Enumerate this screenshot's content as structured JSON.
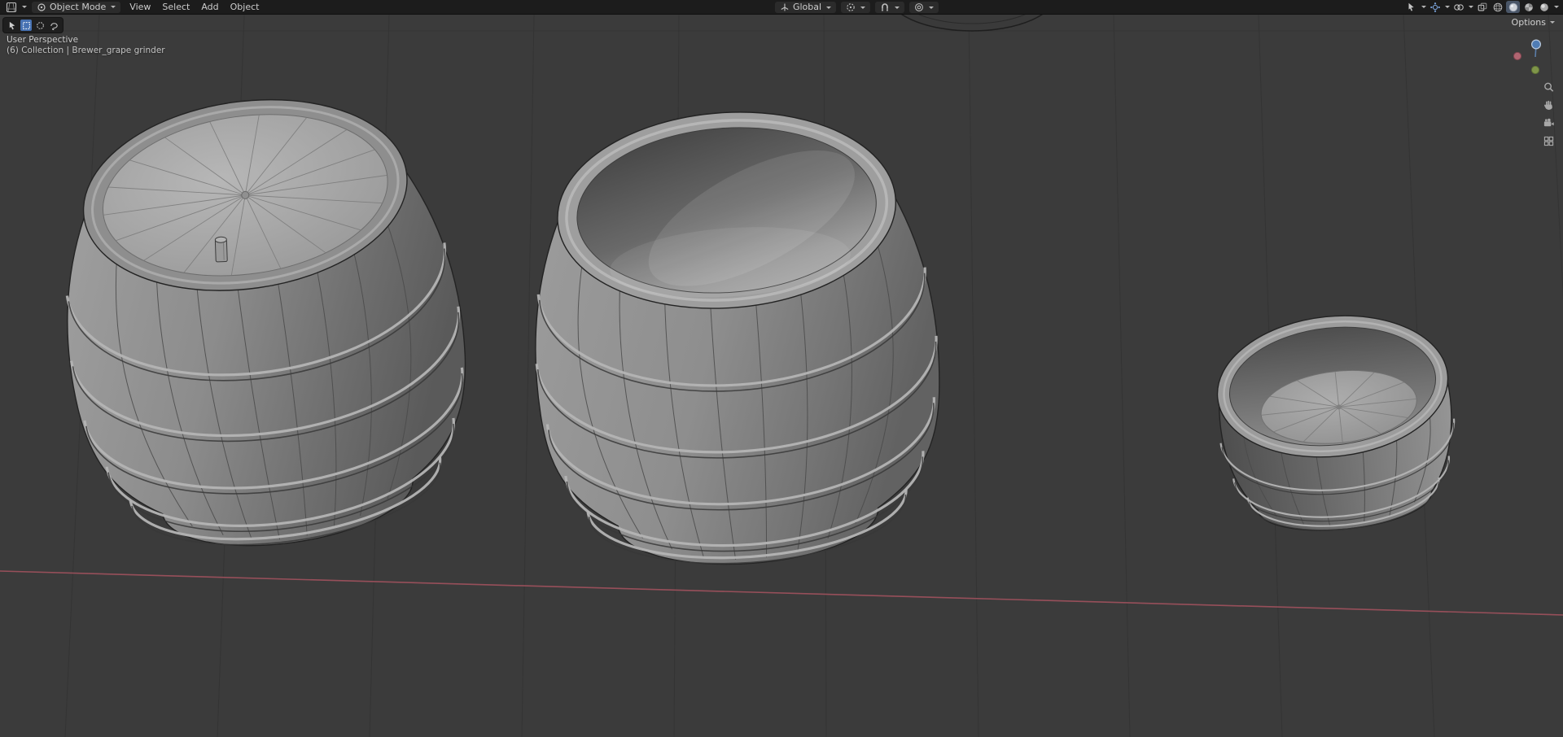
{
  "topbar": {
    "mode_label": "Object Mode",
    "menus": [
      {
        "label": "View"
      },
      {
        "label": "Select"
      },
      {
        "label": "Add"
      },
      {
        "label": "Object"
      }
    ],
    "orientation_label": "Global"
  },
  "tool_header": {
    "options_label": "Options"
  },
  "viewport_overlay": {
    "perspective_label": "User Perspective",
    "collection_label": "(6) Collection | Brewer_grape grinder"
  },
  "icons": {
    "editor_type_icon": "3d-viewport-grid",
    "object_mode_icon": "object-circle",
    "orientation_icon": "global-axes",
    "pivot_icon": "pivot-center-dot",
    "snap_icon": "magnet",
    "proportional_icon": "concentric-circles",
    "pointer_filter_icon": "cursor-arrow",
    "gizmo_toggle_icon": "gizmo-dial",
    "overlays_toggle_icon": "overlapping-circles",
    "xray_toggle_icon": "overlapping-squares",
    "shading_wireframe_icon": "wire-sphere",
    "shading_solid_icon": "solid-sphere",
    "shading_material_icon": "checker-sphere",
    "shading_rendered_icon": "shaded-sphere",
    "tweak_select_icon": "cursor-arrow",
    "box_select_icon": "dashed-square",
    "circle_select_icon": "dashed-circle",
    "lasso_select_icon": "lasso-loop",
    "zoom_icon": "magnifier",
    "pan_icon": "hand",
    "camera_view_icon": "camera",
    "ortho_grid_icon": "grid-squares",
    "nav_gizmo_icon": "axis-ball"
  },
  "colors": {
    "accent_blue": "#4772b3",
    "header_bg": "#1c1c1c",
    "viewport_bg": "#3b3b3b",
    "grid_line": "#343434",
    "x_axis_line": "#a2525e",
    "gizmo_axis_x": "#b06571",
    "gizmo_axis_y": "#7f9549",
    "gizmo_axis_z": "#4f7cb4",
    "object_base_gray": "#8c8c8c"
  }
}
